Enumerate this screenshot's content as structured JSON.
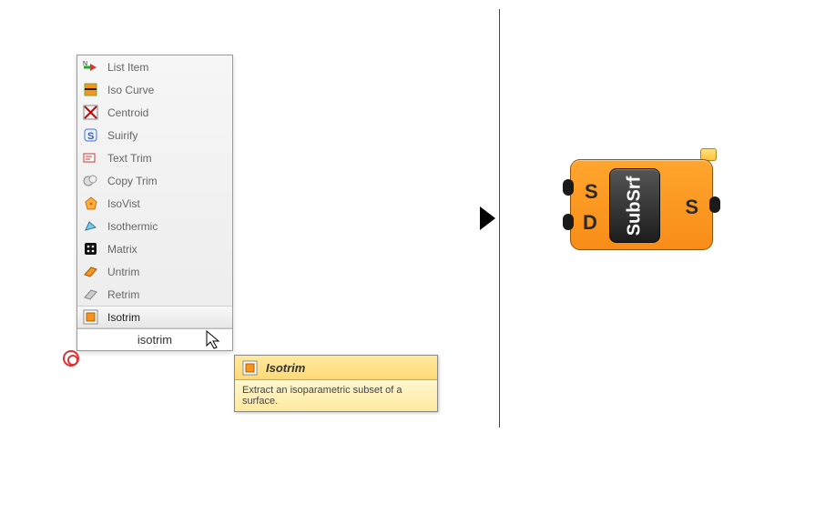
{
  "panel": {
    "items": [
      {
        "icon": "list-item",
        "label": "List Item"
      },
      {
        "icon": "iso-curve",
        "label": "Iso Curve"
      },
      {
        "icon": "centroid",
        "label": "Centroid"
      },
      {
        "icon": "suirify",
        "label": "Suirify"
      },
      {
        "icon": "text-trim",
        "label": "Text Trim"
      },
      {
        "icon": "copy-trim",
        "label": "Copy Trim"
      },
      {
        "icon": "isovist",
        "label": "IsoVist"
      },
      {
        "icon": "isothermic",
        "label": "Isothermic"
      },
      {
        "icon": "matrix",
        "label": "Matrix"
      },
      {
        "icon": "untrim",
        "label": "Untrim"
      },
      {
        "icon": "retrim",
        "label": "Retrim"
      },
      {
        "icon": "isotrim",
        "label": "Isotrim"
      }
    ],
    "search_text": "isotrim",
    "highlighted_index": 11
  },
  "tooltip": {
    "title": "Isotrim",
    "body": "Extract an isoparametric subset of a surface."
  },
  "node": {
    "name": "SubSrf",
    "inputs": [
      "S",
      "D"
    ],
    "outputs": [
      "S"
    ]
  }
}
